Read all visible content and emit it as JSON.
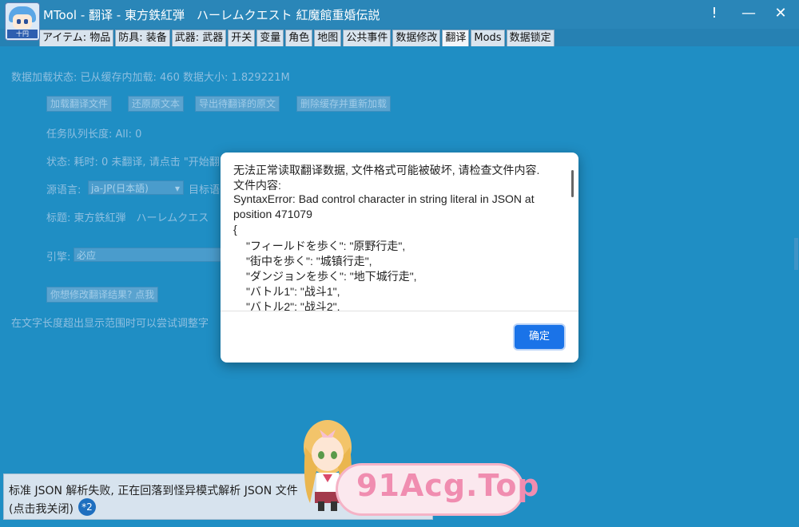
{
  "colors": {
    "background": "#1f8ec4",
    "titlebar": "#2a86b8",
    "tabbar": "#2681b3",
    "dialog_button": "#1a73e8",
    "watermark": "#f08db0"
  },
  "window": {
    "title": "MTool - 翻译 - 東方鉄紅弾　ハーレムクエスト 紅魔館重婚伝説",
    "icon_badge": "十円",
    "alert_glyph": "!",
    "minimize_glyph": "—",
    "close_glyph": "✕"
  },
  "tabs": [
    {
      "label": "アイテム: 物品"
    },
    {
      "label": "防具: 装备"
    },
    {
      "label": "武器: 武器"
    },
    {
      "label": "开关"
    },
    {
      "label": "变量"
    },
    {
      "label": "角色"
    },
    {
      "label": "地图"
    },
    {
      "label": "公共事件"
    },
    {
      "label": "数据修改"
    },
    {
      "label": "翻译"
    },
    {
      "label": "Mods"
    },
    {
      "label": "数据锁定"
    }
  ],
  "active_tab": "翻译",
  "main": {
    "load_status": "数据加载状态: 已从缓存内加载: 460 数据大小: 1.829221M",
    "buttons": {
      "load_translation": "加载翻译文件",
      "restore_original": "还原原文本",
      "export_pending": "导出待翻译的原文",
      "clear_cache": "删除缓存并重新加载"
    },
    "queue_length": "任务队列长度: All: 0",
    "status": "状态: 耗时: 0 未翻译, 请点击 \"开始翻",
    "source_lang_label": "源语言:",
    "source_lang_value": "ja-JP(日本語)",
    "target_lang_label": "目标语",
    "title_label": "标题: 東方鉄紅弾　ハーレムクエス",
    "engine_label": "引擎:",
    "engine_value": "必应",
    "modify_result_button": "你想修改翻译结果? 点我",
    "overflow_hint": "在文字长度超出显示范围时可以尝试调整字"
  },
  "dialog": {
    "lines": [
      "无法正常读取翻译数据, 文件格式可能被破坏, 请检查文件内容.",
      "文件内容:",
      "SyntaxError: Bad control character in string literal in JSON at",
      "position 471079",
      "{"
    ],
    "code_lines": [
      "\"フィールドを歩く\": \"原野行走\",",
      "\"街中を歩く\": \"城镇行走\",",
      "\"ダンジョンを歩く\": \"地下城行走\",",
      "\"バトル1\": \"战斗1\",",
      "\"バトル2\": \"战斗2\","
    ],
    "ok_label": "确定"
  },
  "toast": {
    "line1": "标准 JSON 解析失败, 正在回落到怪异模式解析 JSON 文件",
    "line2": "(点击我关闭)",
    "count": "*2"
  },
  "watermark": {
    "text": "91Acg.Top"
  }
}
